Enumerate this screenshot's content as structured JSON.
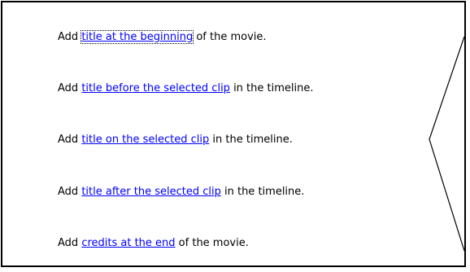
{
  "options": [
    {
      "prefix": "Add ",
      "link": "title at the beginning",
      "suffix": " of the movie."
    },
    {
      "prefix": "Add ",
      "link": "title before the selected clip",
      "suffix": " in the timeline."
    },
    {
      "prefix": "Add ",
      "link": "title on the selected clip",
      "suffix": " in the timeline."
    },
    {
      "prefix": "Add ",
      "link": "title after the selected clip",
      "suffix": " in the timeline."
    },
    {
      "prefix": "Add ",
      "link": "credits at the end",
      "suffix": " of the movie."
    }
  ],
  "colors": {
    "link": "#0000ff",
    "text": "#000000",
    "border": "#000000",
    "background": "#ffffff"
  }
}
